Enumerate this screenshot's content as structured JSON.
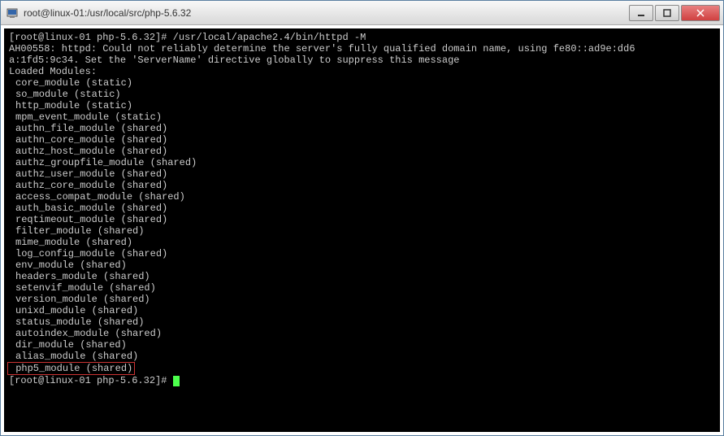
{
  "window": {
    "title": "root@linux-01:/usr/local/src/php-5.6.32"
  },
  "prompt1": {
    "user_host": "[root@linux-01 php-5.6.32]#",
    "command": " /usr/local/apache2.4/bin/httpd -M"
  },
  "warning_line1": "AH00558: httpd: Could not reliably determine the server's fully qualified domain name, using fe80::ad9e:dd6",
  "warning_line2": "a:1fd5:9c34. Set the 'ServerName' directive globally to suppress this message",
  "loaded_modules_header": "Loaded Modules:",
  "modules": [
    "core_module (static)",
    "so_module (static)",
    "http_module (static)",
    "mpm_event_module (static)",
    "authn_file_module (shared)",
    "authn_core_module (shared)",
    "authz_host_module (shared)",
    "authz_groupfile_module (shared)",
    "authz_user_module (shared)",
    "authz_core_module (shared)",
    "access_compat_module (shared)",
    "auth_basic_module (shared)",
    "reqtimeout_module (shared)",
    "filter_module (shared)",
    "mime_module (shared)",
    "log_config_module (shared)",
    "env_module (shared)",
    "headers_module (shared)",
    "setenvif_module (shared)",
    "version_module (shared)",
    "unixd_module (shared)",
    "status_module (shared)",
    "autoindex_module (shared)",
    "dir_module (shared)",
    "alias_module (shared)"
  ],
  "highlighted_module": "php5_module (shared)",
  "prompt2": {
    "user_host": "[root@linux-01 php-5.6.32]#"
  }
}
